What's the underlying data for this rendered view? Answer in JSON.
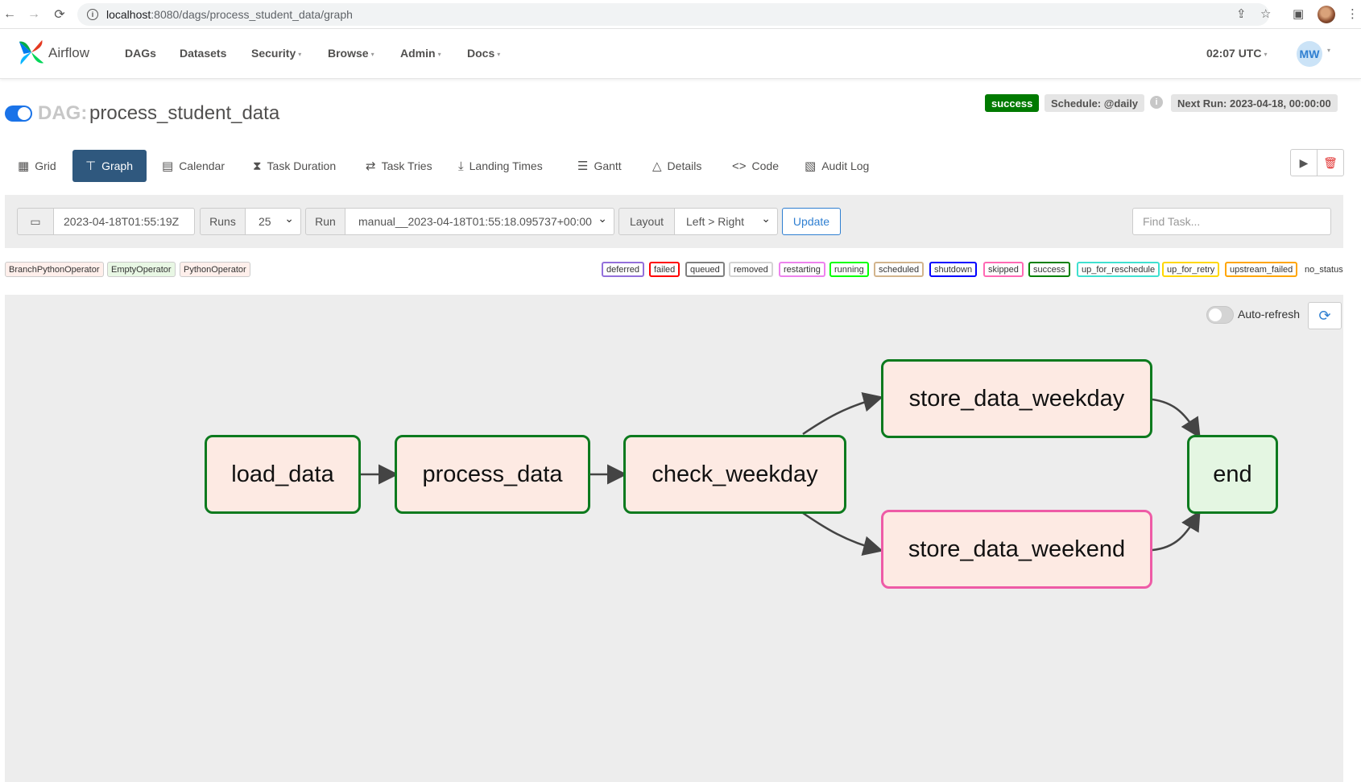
{
  "browser": {
    "url_host": "localhost",
    "url_path": ":8080/dags/process_student_data/graph",
    "back_icon": "←",
    "forward_icon": "→",
    "reload_icon": "⟳"
  },
  "nav": {
    "brand": "Airflow",
    "menu": [
      "DAGs",
      "Datasets",
      "Security",
      "Browse",
      "Admin",
      "Docs"
    ],
    "time": "02:07 UTC",
    "user_initials": "MW"
  },
  "dag": {
    "label": "DAG:",
    "name": "process_student_data",
    "status": "success",
    "schedule": "Schedule: @daily",
    "next_run": "Next Run: 2023-04-18, 00:00:00",
    "colors": {
      "success": "#007a00",
      "skipped": "#ee5ba6",
      "active_tab": "#2f587e",
      "link": "#2f7fd1"
    }
  },
  "tabs": [
    "Grid",
    "Graph",
    "Calendar",
    "Task Duration",
    "Task Tries",
    "Landing Times",
    "Gantt",
    "Details",
    "Code",
    "Audit Log"
  ],
  "filter": {
    "date": "2023-04-18T01:55:19Z",
    "runs_label": "Runs",
    "runs_value": "25",
    "run_label": "Run",
    "run_value": "manual__2023-04-18T01:55:18.095737+00:00",
    "layout_label": "Layout",
    "layout_value": "Left > Right",
    "update_label": "Update",
    "find_placeholder": "Find Task..."
  },
  "legend": {
    "operators": [
      "BranchPythonOperator",
      "EmptyOperator",
      "PythonOperator"
    ],
    "states": [
      "deferred",
      "failed",
      "queued",
      "removed",
      "restarting",
      "running",
      "scheduled",
      "shutdown",
      "skipped",
      "success",
      "up_for_reschedule",
      "up_for_retry",
      "upstream_failed"
    ],
    "no_status": "no_status"
  },
  "graph": {
    "autorefresh_label": "Auto-refresh",
    "nodes": [
      "load_data",
      "process_data",
      "check_weekday",
      "store_data_weekday",
      "store_data_weekend",
      "end"
    ]
  }
}
